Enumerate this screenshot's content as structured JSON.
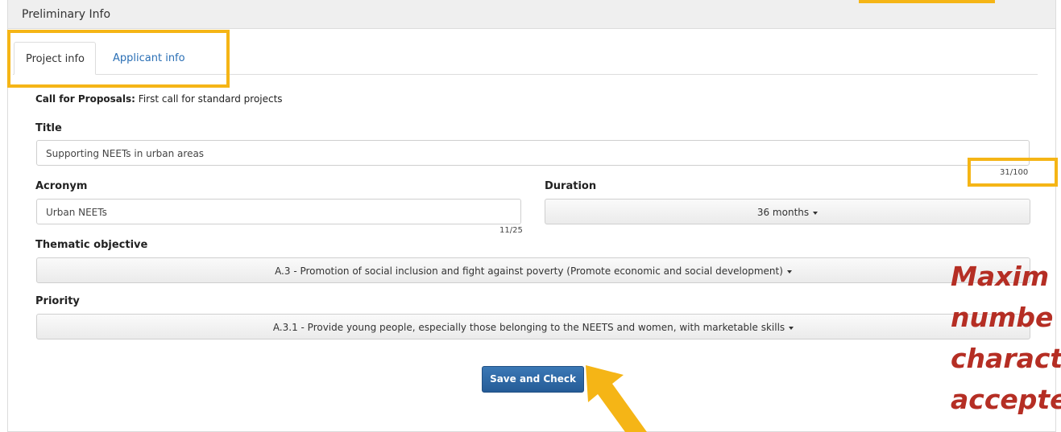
{
  "panel": {
    "title": "Preliminary Info"
  },
  "tabs": [
    {
      "label": "Project info",
      "active": true
    },
    {
      "label": "Applicant info",
      "active": false
    }
  ],
  "call_for_proposals": {
    "label": "Call for Proposals:",
    "value": "First call for standard projects"
  },
  "fields": {
    "title": {
      "label": "Title",
      "value": "Supporting NEETs in urban areas",
      "counter": "31/100"
    },
    "acronym": {
      "label": "Acronym",
      "value": "Urban NEETs",
      "counter": "11/25"
    },
    "duration": {
      "label": "Duration",
      "selected": "36 months"
    },
    "thematic_objective": {
      "label": "Thematic objective",
      "selected": "A.3 - Promotion of social inclusion and fight against poverty (Promote economic and social development)"
    },
    "priority": {
      "label": "Priority",
      "selected": "A.3.1 - Provide young people, especially those belonging to the NEETS and women, with marketable skills"
    }
  },
  "actions": {
    "save_label": "Save and Check"
  },
  "annotation": {
    "lines": [
      "Maxim",
      "numbe",
      "charact",
      "accepte"
    ],
    "color": "#b52e24",
    "highlight_color": "#f5b516"
  }
}
